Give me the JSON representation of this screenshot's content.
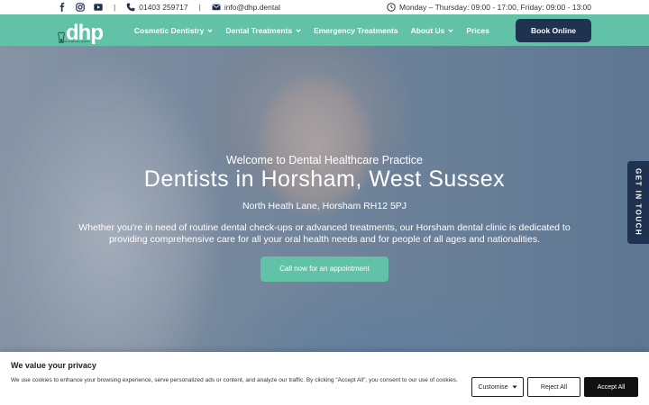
{
  "topbar": {
    "social_icons": [
      "facebook-icon",
      "instagram-icon",
      "youtube-icon"
    ],
    "phone": "01403 259717",
    "email": "info@dhp.dental",
    "hours": "Monday – Thursday: 09:00 - 17:00, Friday: 09:00 - 13:00",
    "separator": "|"
  },
  "nav": {
    "logo_text": "dhp",
    "logo_tagline": "dental healthcare practice",
    "items": [
      {
        "label": "Cosmetic Dentistry",
        "dropdown": true
      },
      {
        "label": "Dental Treatments",
        "dropdown": true
      },
      {
        "label": "Emergency Treatments",
        "dropdown": false
      },
      {
        "label": "About Us",
        "dropdown": true
      },
      {
        "label": "Prices",
        "dropdown": false
      }
    ],
    "book_label": "Book Online"
  },
  "hero": {
    "welcome": "Welcome to Dental Healthcare Practice",
    "headline": "Dentists in Horsham, West Sussex",
    "address": "North Heath Lane, Horsham RH12 5PJ",
    "intro": "Whether you're in need of routine dental check-ups or advanced treatments, our Horsham dental clinic is dedicated to providing comprehensive care for all your oral health needs and for people of all ages and nationalities.",
    "cta_label": "Call now for an appointment"
  },
  "side_tab": {
    "label": "GET IN TOUCH"
  },
  "cookie": {
    "title": "We value your privacy",
    "text": "We use cookies to enhance your browsing experience, serve personalized ads or content, and analyze our traffic. By clicking \"Accept All\", you consent to our use of cookies.",
    "customise_label": "Customise",
    "reject_label": "Reject All",
    "accept_label": "Accept All"
  },
  "colors": {
    "accent": "#62c2a8",
    "navy": "#1f3350"
  }
}
